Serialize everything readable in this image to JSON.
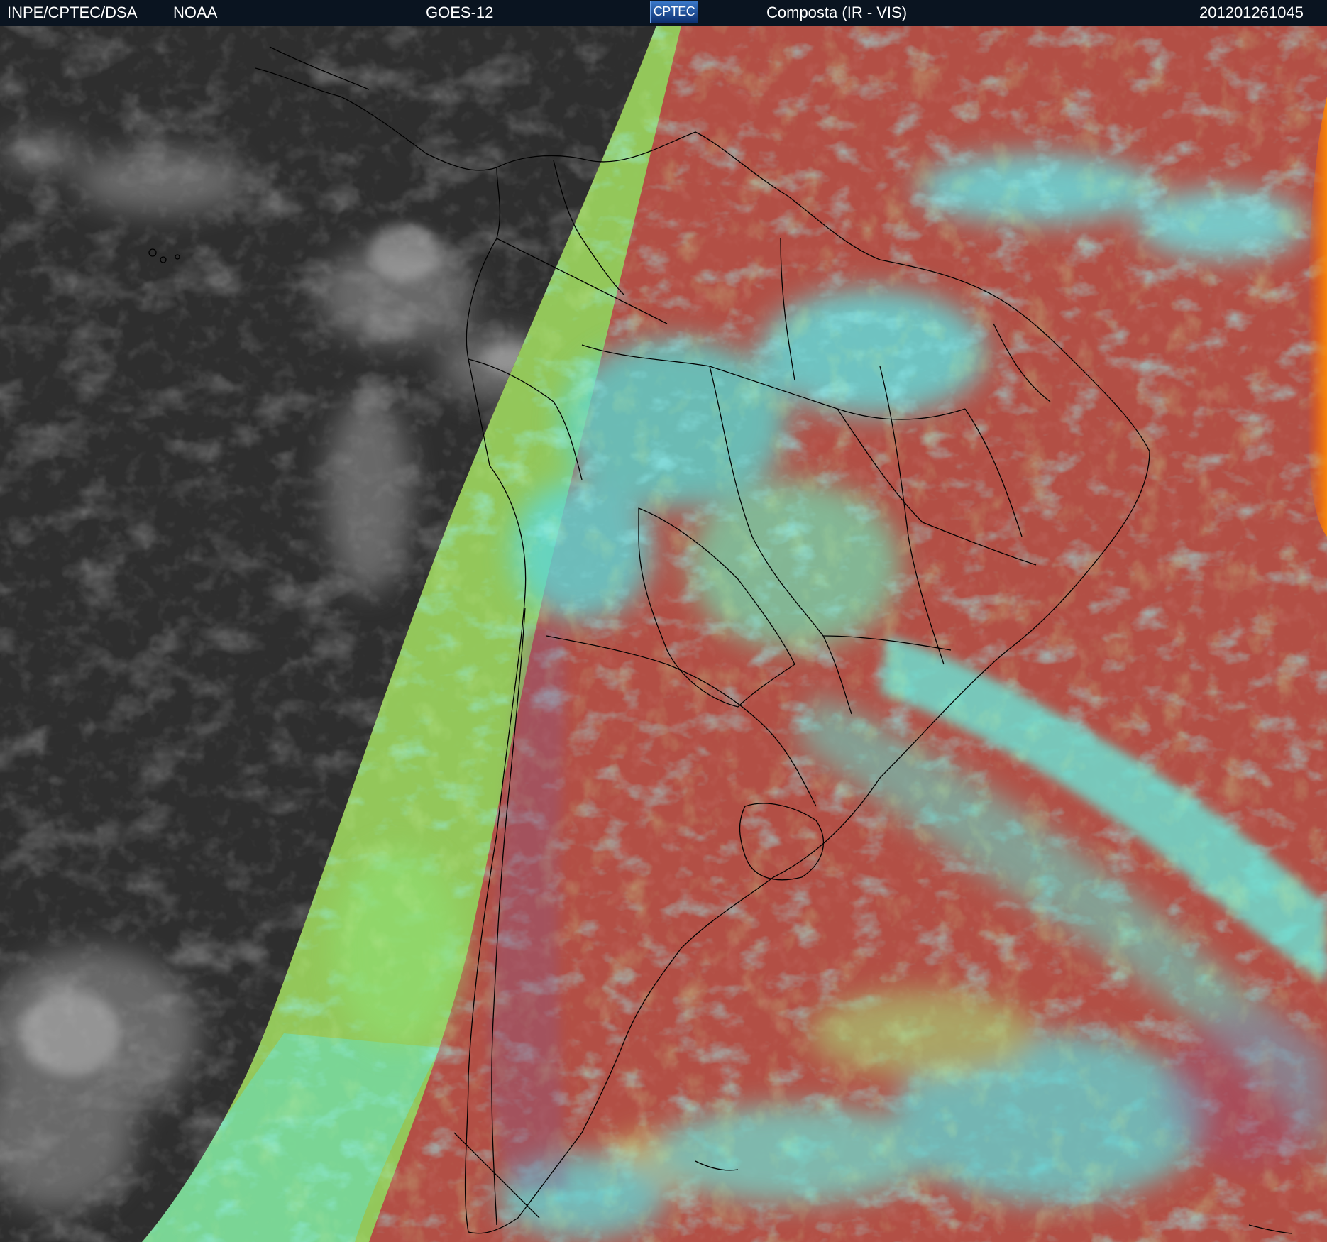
{
  "header": {
    "agency": "INPE/CPTEC/DSA",
    "source": "NOAA",
    "satellite": "GOES-12",
    "logo_text": "CPTEC",
    "product": "Composta (IR - VIS)",
    "timestamp": "201201261045"
  },
  "colors": {
    "header_bg": "#0a1420",
    "night_ir": "#323232",
    "land_day": "#b04f45",
    "cloud_cyan": "#4ee6ea",
    "cloud_green": "#8edc5a",
    "terminator_green": "#90e060",
    "border_lines": "#000000",
    "limb_orange": "#ff6a00"
  },
  "image": {
    "content": "satellite composite of South America",
    "region": "South America",
    "terminator": "day/night boundary"
  }
}
